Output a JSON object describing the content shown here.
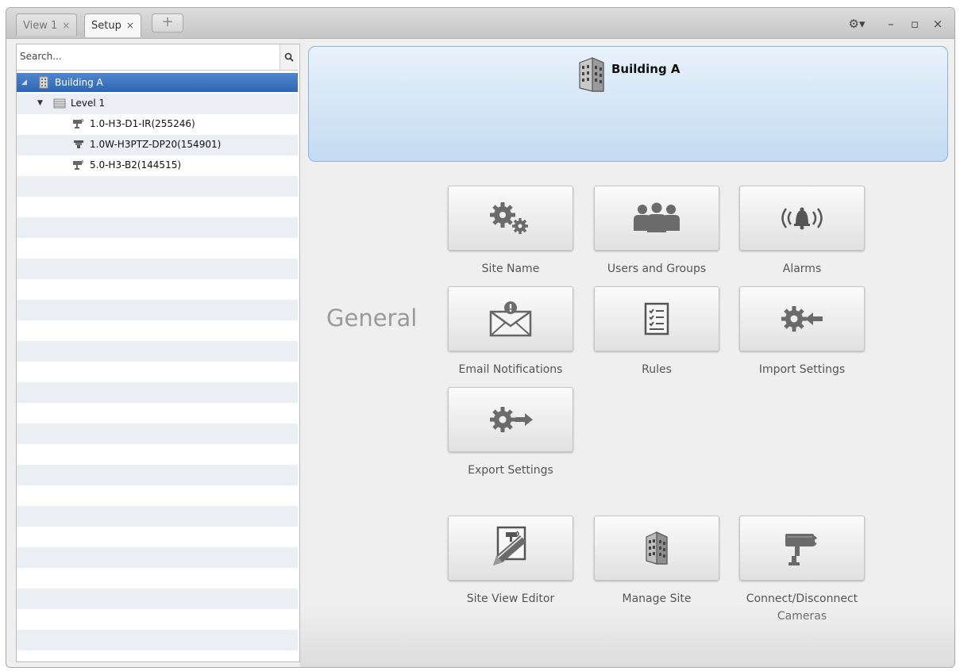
{
  "tabs": [
    {
      "label": "View 1",
      "close": "×"
    },
    {
      "label": "Setup",
      "close": "×"
    }
  ],
  "tab_add_label": "+",
  "window_controls": {
    "settings": "⚙▾",
    "minimize": "–",
    "maximize": "▫",
    "close": "×"
  },
  "search": {
    "placeholder": "Search..."
  },
  "tree": [
    {
      "label": "Building A",
      "level": 0,
      "selected": true,
      "icon": "building-icon"
    },
    {
      "label": "Level 1",
      "level": 1,
      "icon": "level-icon"
    },
    {
      "label": "1.0-H3-D1-IR(255246)",
      "level": 2,
      "icon": "camera-icon"
    },
    {
      "label": "1.0W-H3PTZ-DP20(154901)",
      "level": 2,
      "icon": "ptz-camera-icon"
    },
    {
      "label": "5.0-H3-B2(144515)",
      "level": 2,
      "icon": "camera-icon"
    }
  ],
  "header": {
    "title": "Building A",
    "icon": "building-icon"
  },
  "general": {
    "label": "General",
    "tiles": [
      {
        "label": "Site Name",
        "icon": "gears-icon"
      },
      {
        "label": "Users and Groups",
        "icon": "users-icon"
      },
      {
        "label": "Alarms",
        "icon": "alarm-bell-icon"
      },
      {
        "label": "Email Notifications",
        "icon": "email-icon"
      },
      {
        "label": "Rules",
        "icon": "checklist-icon"
      },
      {
        "label": "Import Settings",
        "icon": "gear-import-icon"
      },
      {
        "label": "Export Settings",
        "icon": "gear-export-icon"
      }
    ]
  },
  "site_tiles": [
    {
      "label": "Site View Editor",
      "icon": "site-view-editor-icon"
    },
    {
      "label": "Manage Site",
      "icon": "manage-site-icon"
    },
    {
      "label": "Connect/Disconnect Cameras",
      "icon": "camera-connect-icon"
    }
  ],
  "colors": {
    "accent": "#3571c0",
    "header_bg": "#c3dbf1",
    "tile_icon": "#6b6b6b"
  }
}
